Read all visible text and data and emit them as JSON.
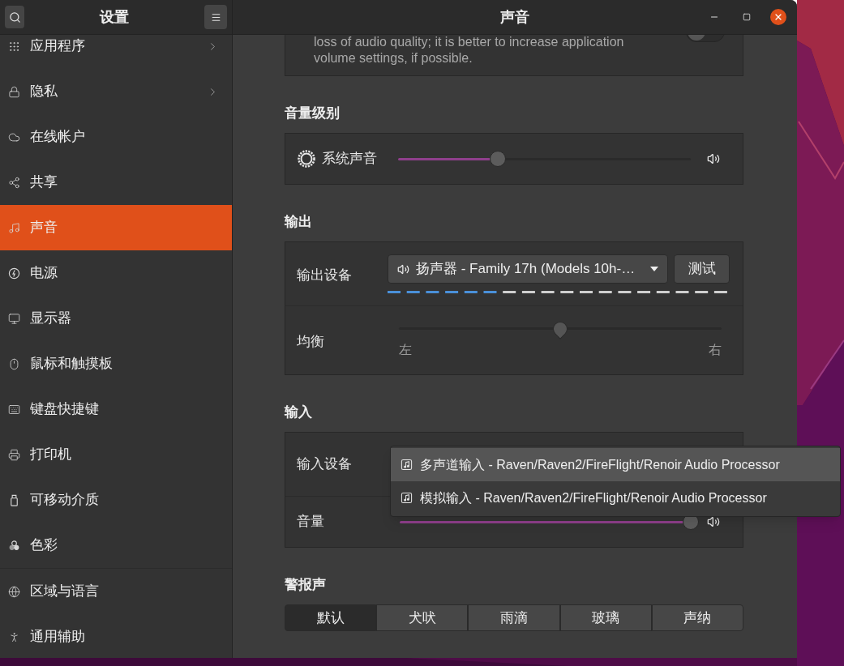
{
  "sidebar": {
    "title": "设置",
    "groups": [
      [
        {
          "label": "应用程序",
          "has_submenu": true,
          "selected": false
        },
        {
          "label": "隐私",
          "has_submenu": true,
          "selected": false
        },
        {
          "label": "在线帐户",
          "has_submenu": false,
          "selected": false
        },
        {
          "label": "共享",
          "has_submenu": false,
          "selected": false
        },
        {
          "label": "声音",
          "has_submenu": false,
          "selected": true
        },
        {
          "label": "电源",
          "has_submenu": false,
          "selected": false
        },
        {
          "label": "显示器",
          "has_submenu": false,
          "selected": false
        },
        {
          "label": "鼠标和触摸板",
          "has_submenu": false,
          "selected": false
        },
        {
          "label": "键盘快捷键",
          "has_submenu": false,
          "selected": false
        },
        {
          "label": "打印机",
          "has_submenu": false,
          "selected": false
        },
        {
          "label": "可移动介质",
          "has_submenu": false,
          "selected": false
        },
        {
          "label": "色彩",
          "has_submenu": false,
          "selected": false
        }
      ],
      [
        {
          "label": "区域与语言",
          "has_submenu": false,
          "selected": false
        },
        {
          "label": "通用辅助",
          "has_submenu": false,
          "selected": false
        }
      ]
    ]
  },
  "window": {
    "title": "声音"
  },
  "notice": {
    "text": "loss of audio quality; it is better to increase application volume settings, if possible.",
    "on": false
  },
  "volume_levels": {
    "heading": "音量级别",
    "rows": [
      {
        "label": "系统声音",
        "level": 0.34
      }
    ]
  },
  "output": {
    "heading": "输出",
    "device_label": "输出设备",
    "device": "扬声器 - Family 17h (Models 10h-…",
    "test_button": "测试",
    "meter": {
      "level": 0.33
    },
    "balance": {
      "label": "均衡",
      "level": 0.5,
      "left": "左",
      "right": "右"
    }
  },
  "input": {
    "heading": "输入",
    "device_label": "输入设备",
    "volume": {
      "label": "音量",
      "level": 1
    }
  },
  "device_menu": {
    "items": [
      {
        "label": "多声道输入 - Raven/Raven2/FireFlight/Renoir Audio Processor",
        "selected": true
      },
      {
        "label": "模拟输入 - Raven/Raven2/FireFlight/Renoir Audio Processor",
        "selected": false
      }
    ]
  },
  "alert_sounds": {
    "heading": "警报声",
    "options": [
      {
        "label": "默认",
        "selected": true
      },
      {
        "label": "犬吠",
        "selected": false
      },
      {
        "label": "雨滴",
        "selected": false
      },
      {
        "label": "玻璃",
        "selected": false
      },
      {
        "label": "声纳",
        "selected": false
      }
    ]
  }
}
